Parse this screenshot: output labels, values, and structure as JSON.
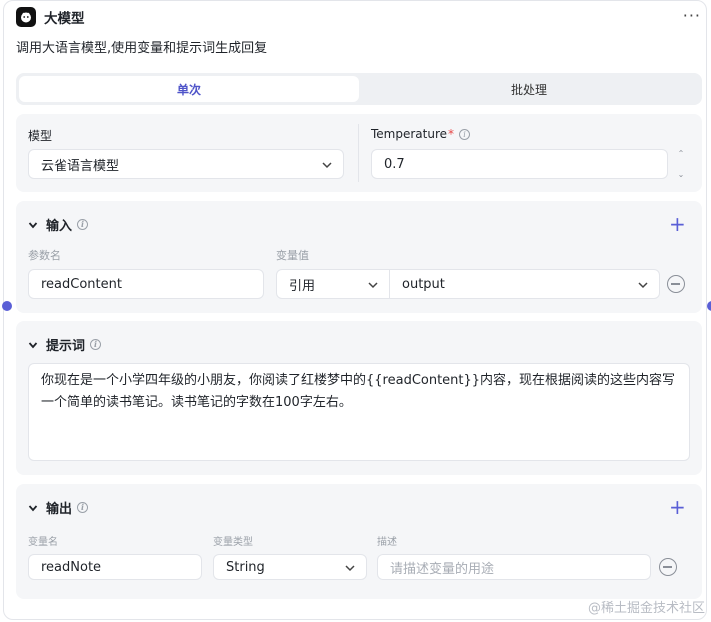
{
  "node": {
    "title": "大模型",
    "description": "调用大语言模型,使用变量和提示词生成回复",
    "more_label": "···"
  },
  "tabs": [
    {
      "label": "单次",
      "active": true
    },
    {
      "label": "批处理",
      "active": false
    }
  ],
  "model": {
    "label": "模型",
    "value": "云雀语言模型",
    "temperature_label": "Temperature",
    "temperature_required": "*",
    "temperature_value": "0.7"
  },
  "input": {
    "title": "输入",
    "param_name_label": "参数名",
    "var_value_label": "变量值",
    "rows": [
      {
        "name": "readContent",
        "type": "引用",
        "value": "output"
      }
    ]
  },
  "prompt": {
    "title": "提示词",
    "text": "你现在是一个小学四年级的小朋友，你阅读了红楼梦中的{{readContent}}内容，现在根据阅读的这些内容写一个简单的读书笔记。读书笔记的字数在100字左右。"
  },
  "output": {
    "title": "输出",
    "var_name_label": "变量名",
    "var_type_label": "变量类型",
    "desc_label": "描述",
    "rows": [
      {
        "name": "readNote",
        "type": "String",
        "description_placeholder": "请描述变量的用途"
      }
    ]
  },
  "watermark": "@稀土掘金技术社区",
  "colors": {
    "accent": "#5a5fd6",
    "card_bg": "#f5f6f8",
    "required": "#e54545"
  }
}
